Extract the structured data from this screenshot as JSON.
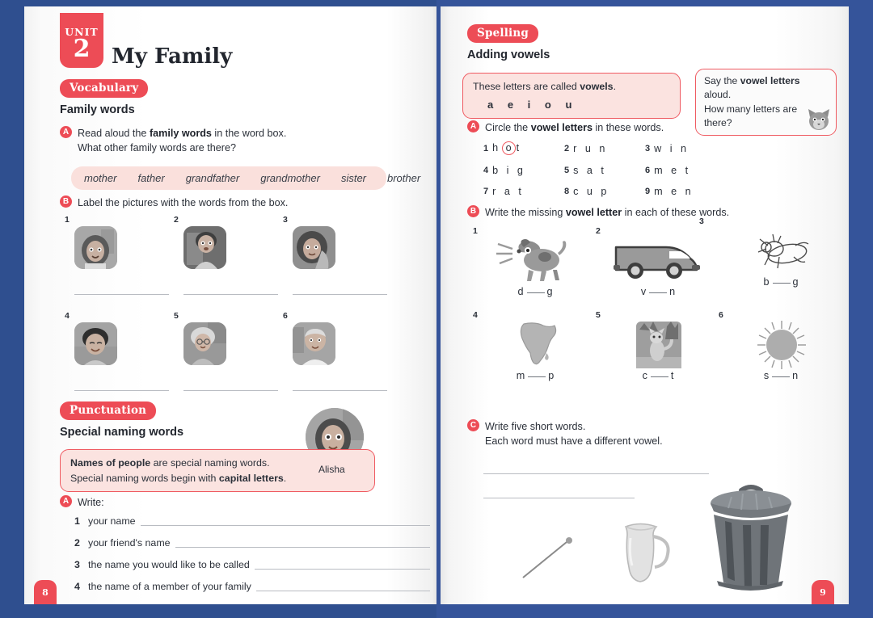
{
  "colors": {
    "accent": "#ed4c56",
    "pink_fill": "#fbe3e0",
    "bg": "#2f4f8f",
    "rule": "#b9bcc2"
  },
  "left_page": {
    "unit_label": "UNIT",
    "unit_number": "2",
    "title": "My Family",
    "page_number": "8",
    "vocabulary": {
      "tag": "Vocabulary",
      "subhead": "Family words",
      "exercise_a": {
        "badge": "A",
        "line1_pre": "Read aloud the ",
        "line1_bold": "family words",
        "line1_post": " in the word box.",
        "line2": "What other family words are there?"
      },
      "word_box": [
        "mother",
        "father",
        "grandfather",
        "grandmother",
        "sister",
        "brother"
      ],
      "exercise_b": {
        "badge": "B",
        "text": "Label the pictures with the words from the box."
      },
      "pictures": [
        {
          "num": "1",
          "alt": "girl-portrait"
        },
        {
          "num": "2",
          "alt": "boy-portrait"
        },
        {
          "num": "3",
          "alt": "woman-portrait"
        },
        {
          "num": "4",
          "alt": "man-portrait"
        },
        {
          "num": "5",
          "alt": "grandmother-portrait"
        },
        {
          "num": "6",
          "alt": "grandfather-portrait"
        }
      ]
    },
    "punctuation": {
      "tag": "Punctuation",
      "subhead": "Special naming words",
      "info_line1_bold": "Names of people",
      "info_line1_rest": " are special naming words.",
      "info_line2_pre": "Special naming words begin with ",
      "info_line2_bold": "capital letters",
      "info_line2_post": ".",
      "avatar_caption": "Alisha",
      "exercise_a": {
        "badge": "A",
        "text": "Write:"
      },
      "items": [
        {
          "num": "1",
          "text": "your name"
        },
        {
          "num": "2",
          "text": "your friend's name"
        },
        {
          "num": "3",
          "text": "the name you would like to be called"
        },
        {
          "num": "4",
          "text": "the name of a member of your family"
        }
      ]
    }
  },
  "right_page": {
    "page_number": "9",
    "spelling": {
      "tag": "Spelling",
      "subhead": "Adding vowels",
      "vowel_box": {
        "text_pre": "These letters are called ",
        "text_bold": "vowels",
        "text_post": ".",
        "letters": "a e i o u"
      },
      "tip_box": {
        "line1_pre": "Say the ",
        "line1_bold": "vowel letters",
        "line1_post": " aloud.",
        "line2": "How many letters are",
        "line3": "there?",
        "mascot": "cat-face-icon"
      },
      "exercise_a": {
        "badge": "A",
        "text_pre": "Circle the ",
        "text_bold": "vowel letters",
        "text_post": " in these words.",
        "words": [
          {
            "num": "1",
            "pre": "h",
            "circled": "o",
            "post": "t"
          },
          {
            "num": "2",
            "pre": "r u n",
            "circled": "",
            "post": ""
          },
          {
            "num": "3",
            "pre": "w i n",
            "circled": "",
            "post": ""
          },
          {
            "num": "4",
            "pre": "b i g",
            "circled": "",
            "post": ""
          },
          {
            "num": "5",
            "pre": "s a t",
            "circled": "",
            "post": ""
          },
          {
            "num": "6",
            "pre": "m e t",
            "circled": "",
            "post": ""
          },
          {
            "num": "7",
            "pre": "r a t",
            "circled": "",
            "post": ""
          },
          {
            "num": "8",
            "pre": "c u p",
            "circled": "",
            "post": ""
          },
          {
            "num": "9",
            "pre": "m e n",
            "circled": "",
            "post": ""
          }
        ]
      },
      "exercise_b": {
        "badge": "B",
        "text_pre": "Write the missing ",
        "text_bold": "vowel letter",
        "text_post": " in each of these words.",
        "items": [
          {
            "num": "1",
            "picture": "dog-illustration",
            "before": "d",
            "after": "g"
          },
          {
            "num": "2",
            "picture": "van-illustration",
            "before": "v",
            "after": "n"
          },
          {
            "num": "3",
            "picture": "bug-illustration",
            "before": "b",
            "after": "g"
          },
          {
            "num": "4",
            "picture": "map-africa-illustration",
            "before": "m",
            "after": "p"
          },
          {
            "num": "5",
            "picture": "cat-illustration",
            "before": "c",
            "after": "t"
          },
          {
            "num": "6",
            "picture": "sun-illustration",
            "before": "s",
            "after": "n"
          }
        ]
      },
      "exercise_c": {
        "badge": "C",
        "line1": "Write five short words.",
        "line2": "Each word must have a different vowel.",
        "answer_lines": 5
      },
      "decorations": [
        "pin-illustration",
        "jug-illustration",
        "bin-illustration"
      ]
    }
  }
}
